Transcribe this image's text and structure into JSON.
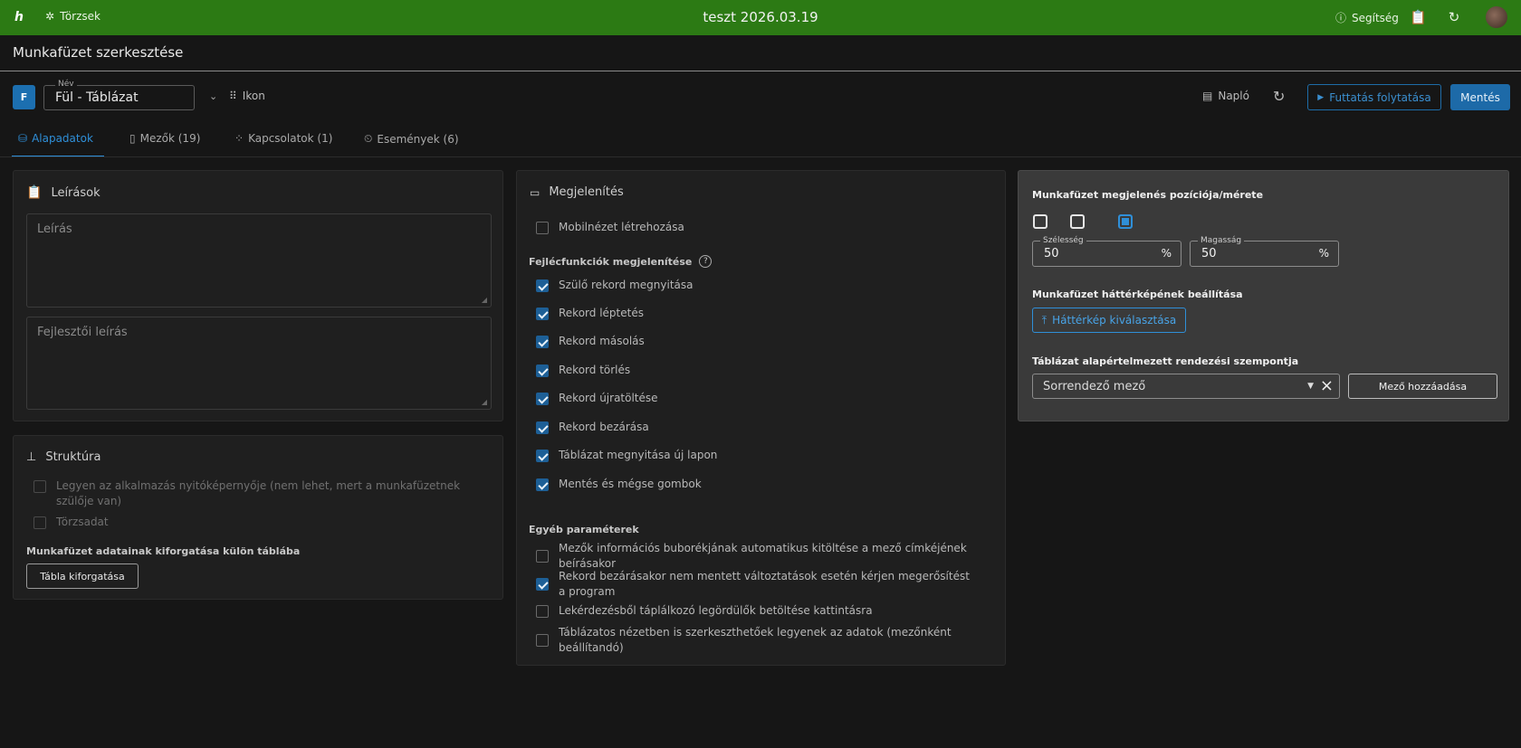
{
  "topbar": {
    "logo": "h",
    "torzsek_label": "Törzsek",
    "title": "teszt 2026.03.19",
    "help_label": "Segítség",
    "bg_color": "#2c7a14"
  },
  "header": {
    "page_title": "Munkafüzet szerkesztése",
    "badge": "F",
    "name_legend": "Név",
    "name_value": "Fül - Táblázat",
    "ikon_label": "Ikon",
    "naplo_label": "Napló",
    "run_label": "Futtatás folytatása",
    "save_label": "Mentés",
    "accent": "#1d6aa8"
  },
  "tabs": [
    {
      "label": "Alapadatok",
      "icon": "database-icon",
      "active": true
    },
    {
      "label": "Mezők (19)",
      "icon": "fields-icon",
      "active": false
    },
    {
      "label": "Kapcsolatok (1)",
      "icon": "relations-icon",
      "active": false
    },
    {
      "label": "Események (6)",
      "icon": "events-icon",
      "active": false
    }
  ],
  "leirasok": {
    "title": "Leírások",
    "desc_placeholder": "Leírás",
    "dev_desc_placeholder": "Fejlesztői leírás"
  },
  "struktura": {
    "title": "Struktúra",
    "opt_start_screen": "Legyen az alkalmazás nyitóképernyője (nem lehet, mert a munkafüzetnek szülője van)",
    "opt_master": "Törzsadat",
    "section_label": "Munkafüzet adatainak kiforgatása külön táblába",
    "button_label": "Tábla kiforgatása"
  },
  "megjelenites": {
    "title": "Megjelenítés",
    "mobile": {
      "label": "Mobilnézet létrehozása",
      "checked": false
    },
    "header_functions_label": "Fejlécfunkciók megjelenítése",
    "header_functions": [
      {
        "label": "Szülő rekord megnyitása",
        "checked": true
      },
      {
        "label": "Rekord léptetés",
        "checked": true
      },
      {
        "label": "Rekord másolás",
        "checked": true
      },
      {
        "label": "Rekord törlés",
        "checked": true
      },
      {
        "label": "Rekord újratöltése",
        "checked": true
      },
      {
        "label": "Rekord bezárása",
        "checked": true
      },
      {
        "label": "Táblázat megnyitása új lapon",
        "checked": true
      },
      {
        "label": "Mentés és mégse gombok",
        "checked": true
      }
    ],
    "other_params_label": "Egyéb paraméterek",
    "other_params": [
      {
        "label": "Mezők információs buborékjának automatikus kitöltése a mező címkéjének beírásakor",
        "checked": false
      },
      {
        "label": "Rekord bezárásakor nem mentett változtatások esetén kérjen megerősítést a program",
        "checked": true
      },
      {
        "label": "Lekérdezésből táplálkozó legördülők betöltése kattintásra",
        "checked": false
      },
      {
        "label": "Táblázatos nézetben is szerkeszthetőek legyenek az adatok (mezőnként beállítandó)",
        "checked": false
      }
    ]
  },
  "right_panel": {
    "position_title": "Munkafüzet megjelenés pozíciója/mérete",
    "width_legend": "Szélesség",
    "width_value": "50",
    "height_legend": "Magasság",
    "height_value": "50",
    "unit": "%",
    "bg_title": "Munkafüzet háttérképének beállítása",
    "bg_button": "Háttérkép kiválasztása",
    "sort_title": "Táblázat alapértelmezett rendezési szempontja",
    "sort_placeholder": "Sorrendező mező",
    "add_field_button": "Mező hozzáadása"
  }
}
